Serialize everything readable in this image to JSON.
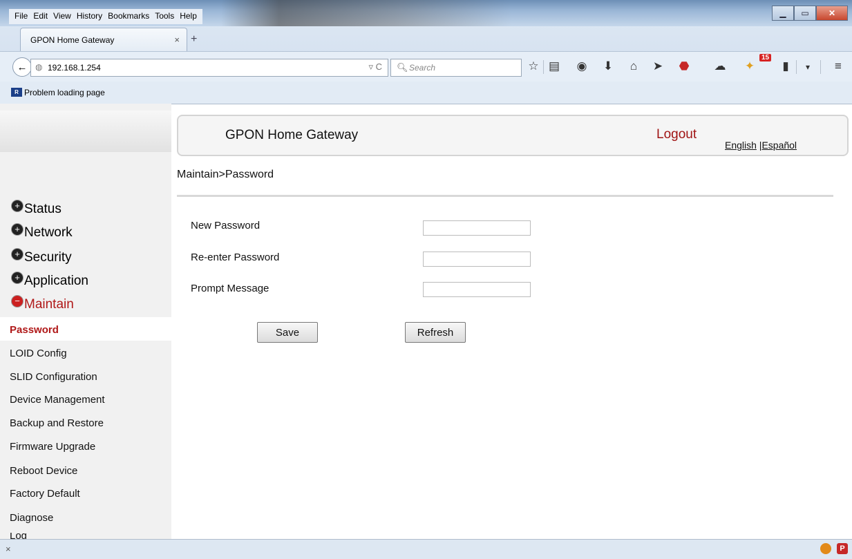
{
  "browser": {
    "menu": [
      "File",
      "Edit",
      "View",
      "History",
      "Bookmarks",
      "Tools",
      "Help"
    ],
    "tab_title": "GPON Home Gateway",
    "tab_close": "×",
    "new_tab": "+",
    "url": "192.168.1.254",
    "search_placeholder": "Search",
    "bookmark_label": "Problem loading page",
    "notification_count": "15",
    "status_close": "×"
  },
  "header": {
    "title": "GPON Home Gateway",
    "logout": "Logout",
    "lang_english": "English",
    "lang_sep": " |",
    "lang_spanish": "Español"
  },
  "breadcrumb": "Maintain>Password",
  "sidebar": {
    "top_items": [
      {
        "label": "Status"
      },
      {
        "label": "Network"
      },
      {
        "label": "Security"
      },
      {
        "label": "Application"
      },
      {
        "label": "Maintain"
      }
    ],
    "sub_items": [
      {
        "label": "Password"
      },
      {
        "label": "LOID Config"
      },
      {
        "label": "SLID Configuration"
      },
      {
        "label": "Device Management"
      },
      {
        "label": "Backup and Restore"
      },
      {
        "label": "Firmware Upgrade"
      },
      {
        "label": "Reboot Device"
      },
      {
        "label": "Factory Default"
      },
      {
        "label": "Diagnose"
      },
      {
        "label": "Log"
      }
    ]
  },
  "form": {
    "new_password_label": "New Password",
    "new_password_value": "",
    "reenter_label": "Re-enter Password",
    "reenter_value": "",
    "prompt_label": "Prompt Message",
    "prompt_value": "",
    "save_label": "Save",
    "refresh_label": "Refresh"
  },
  "colors": {
    "accent_red": "#a01414",
    "sidebar_bg": "#f1f1f1"
  }
}
